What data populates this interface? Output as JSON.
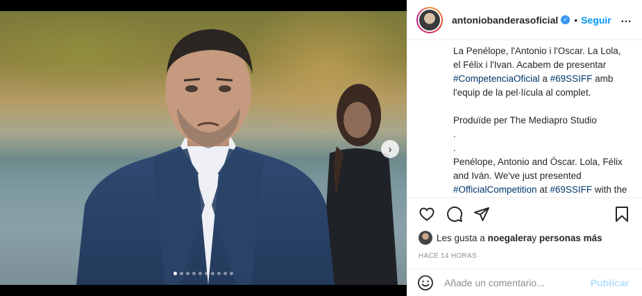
{
  "carousel": {
    "dot_count": 10,
    "active_dot": 0,
    "next_icon": "chevron-right-icon"
  },
  "post": {
    "username": "antoniobanderasoficial",
    "separator": "•",
    "follow_label": "Seguir",
    "more_icon": "…",
    "caption_lines": [
      {
        "parts": [
          {
            "t": "La Penélope, l'Antonio i l'Oscar. La Lola, el Félix i l'Ivan. Acabem de presentar "
          },
          {
            "t": "#CompetenciaOficial",
            "tag": true
          },
          {
            "t": " a "
          },
          {
            "t": "#69SSIFF",
            "tag": true
          },
          {
            "t": " amb l'equip de la pel·lícula al complet."
          }
        ]
      },
      {
        "gap": true
      },
      {
        "parts": [
          {
            "t": "Produïde per The Mediapro Studio"
          }
        ]
      },
      {
        "parts": [
          {
            "t": "."
          }
        ]
      },
      {
        "parts": [
          {
            "t": "."
          }
        ]
      },
      {
        "parts": [
          {
            "t": "Penélope, Antonio and Óscar. Lola, Félix and Iván. We've just presented "
          },
          {
            "t": "#OfficialCompetition",
            "tag": true
          },
          {
            "t": " at "
          },
          {
            "t": "#69SSIFF",
            "tag": true
          },
          {
            "t": " with the entire team of the film."
          }
        ]
      }
    ],
    "likes": {
      "prefix": "Les gusta a ",
      "user": "noegalera",
      "middle": " y ",
      "others": "personas más"
    },
    "time": "HACE 14 HORAS",
    "comment_placeholder": "Añade un comentario...",
    "publish_label": "Publicar"
  },
  "colors": {
    "link": "#00376b",
    "follow": "#0095f6",
    "publish_disabled": "#b2dffc",
    "verified": "#3897f0"
  }
}
